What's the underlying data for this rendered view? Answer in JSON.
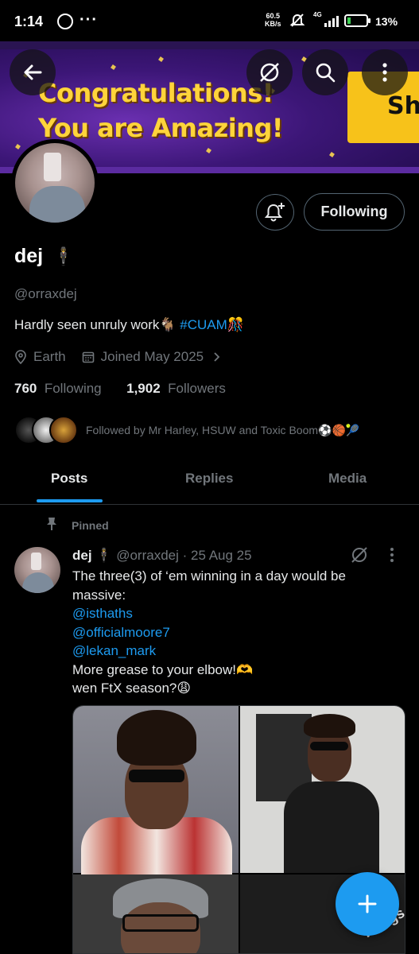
{
  "status_bar": {
    "time": "1:14",
    "more": "···",
    "speed_value": "60.5",
    "speed_unit": "KB/s",
    "network": "4G",
    "battery": "13%"
  },
  "banner": {
    "line1": "Congratulations!",
    "line2": "You are Amazing!",
    "badge_text": "Sh"
  },
  "profile": {
    "name": "dej",
    "name_emoji": "🕴",
    "handle": "@orraxdej",
    "bio_text": "Hardly seen unruly work🐐 ",
    "bio_tag": "#CUAM",
    "bio_emoji": "🎊",
    "location": "Earth",
    "joined": "Joined May 2025",
    "following_count": "760",
    "following_label": "Following",
    "followers_count": "1,902",
    "followers_label": "Followers",
    "followed_by": "Followed by Mr Harley, HSUW and Toxic Boom⚽🏀🎾",
    "follow_button": "Following"
  },
  "tabs": [
    {
      "label": "Posts",
      "active": true
    },
    {
      "label": "Replies",
      "active": false
    },
    {
      "label": "Media",
      "active": false
    }
  ],
  "post": {
    "pinned_label": "Pinned",
    "author_name": "dej",
    "author_emoji": "🕴",
    "author_handle": "@orraxdej",
    "date": "· 25 Aug 25",
    "text_line1": "The three(3) of ‘em winning in a day would be",
    "text_line2": "massive:",
    "mentions": [
      "@isthaths",
      "@officialmoore7",
      "@lekan_mark"
    ],
    "text_line3": "More grease to your elbow!🫶",
    "text_line4": "wen FtX season?😩",
    "image_caption": "Things."
  },
  "colors": {
    "accent": "#1d9bf0",
    "secondary_text": "#71767b",
    "primary_text": "#e7e9ea",
    "background": "#000000",
    "banner_text": "#ffd43b"
  },
  "icons": {
    "back": "arrow-left-icon",
    "grok": "grok-icon",
    "search": "search-icon",
    "more": "more-vertical-icon",
    "bell": "bell-plus-icon",
    "location": "location-pin-icon",
    "calendar": "calendar-icon",
    "chevron": "chevron-right-icon",
    "pin": "pin-icon",
    "compose": "plus-icon"
  }
}
